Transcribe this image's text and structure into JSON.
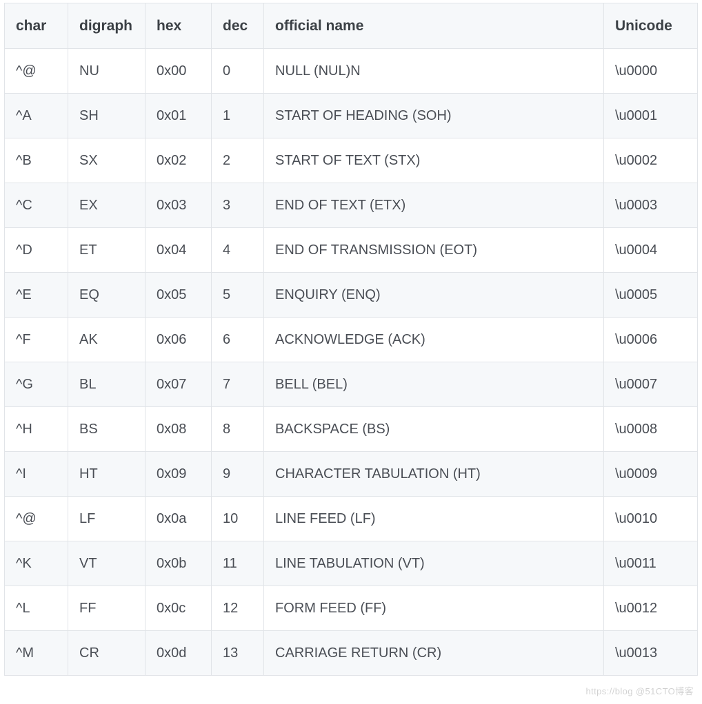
{
  "headers": {
    "char": "char",
    "digraph": "digraph",
    "hex": "hex",
    "dec": "dec",
    "official_name": "official name",
    "unicode": "Unicode"
  },
  "rows": [
    {
      "char": "^@",
      "digraph": "NU",
      "hex": "0x00",
      "dec": "0",
      "official_name": "NULL (NUL)N",
      "unicode": "\\u0000"
    },
    {
      "char": "^A",
      "digraph": "SH",
      "hex": "0x01",
      "dec": "1",
      "official_name": "START OF HEADING (SOH)",
      "unicode": "\\u0001"
    },
    {
      "char": "^B",
      "digraph": "SX",
      "hex": "0x02",
      "dec": "2",
      "official_name": "START OF TEXT (STX)",
      "unicode": "\\u0002"
    },
    {
      "char": "^C",
      "digraph": "EX",
      "hex": "0x03",
      "dec": "3",
      "official_name": "END OF TEXT (ETX)",
      "unicode": "\\u0003"
    },
    {
      "char": "^D",
      "digraph": "ET",
      "hex": "0x04",
      "dec": "4",
      "official_name": "END OF TRANSMISSION (EOT)",
      "unicode": "\\u0004"
    },
    {
      "char": "^E",
      "digraph": "EQ",
      "hex": "0x05",
      "dec": "5",
      "official_name": "ENQUIRY (ENQ)",
      "unicode": "\\u0005"
    },
    {
      "char": "^F",
      "digraph": "AK",
      "hex": "0x06",
      "dec": "6",
      "official_name": "ACKNOWLEDGE (ACK)",
      "unicode": "\\u0006"
    },
    {
      "char": "^G",
      "digraph": "BL",
      "hex": "0x07",
      "dec": "7",
      "official_name": "BELL (BEL)",
      "unicode": "\\u0007"
    },
    {
      "char": "^H",
      "digraph": "BS",
      "hex": "0x08",
      "dec": "8",
      "official_name": "BACKSPACE (BS)",
      "unicode": "\\u0008"
    },
    {
      "char": "^I",
      "digraph": "HT",
      "hex": "0x09",
      "dec": "9",
      "official_name": "CHARACTER TABULATION (HT)",
      "unicode": "\\u0009"
    },
    {
      "char": "^@",
      "digraph": "LF",
      "hex": "0x0a",
      "dec": "10",
      "official_name": "LINE FEED (LF)",
      "unicode": "\\u0010"
    },
    {
      "char": "^K",
      "digraph": "VT",
      "hex": "0x0b",
      "dec": "11",
      "official_name": "LINE TABULATION (VT)",
      "unicode": "\\u0011"
    },
    {
      "char": "^L",
      "digraph": "FF",
      "hex": "0x0c",
      "dec": "12",
      "official_name": "FORM FEED (FF)",
      "unicode": "\\u0012"
    },
    {
      "char": "^M",
      "digraph": "CR",
      "hex": "0x0d",
      "dec": "13",
      "official_name": "CARRIAGE RETURN (CR)",
      "unicode": "\\u0013"
    }
  ],
  "watermark": "https://blog  @51CTO博客",
  "chart_data": {
    "type": "table",
    "title": "",
    "columns": [
      "char",
      "digraph",
      "hex",
      "dec",
      "official name",
      "Unicode"
    ],
    "rows": [
      [
        "^@",
        "NU",
        "0x00",
        0,
        "NULL (NUL)N",
        "\\u0000"
      ],
      [
        "^A",
        "SH",
        "0x01",
        1,
        "START OF HEADING (SOH)",
        "\\u0001"
      ],
      [
        "^B",
        "SX",
        "0x02",
        2,
        "START OF TEXT (STX)",
        "\\u0002"
      ],
      [
        "^C",
        "EX",
        "0x03",
        3,
        "END OF TEXT (ETX)",
        "\\u0003"
      ],
      [
        "^D",
        "ET",
        "0x04",
        4,
        "END OF TRANSMISSION (EOT)",
        "\\u0004"
      ],
      [
        "^E",
        "EQ",
        "0x05",
        5,
        "ENQUIRY (ENQ)",
        "\\u0005"
      ],
      [
        "^F",
        "AK",
        "0x06",
        6,
        "ACKNOWLEDGE (ACK)",
        "\\u0006"
      ],
      [
        "^G",
        "BL",
        "0x07",
        7,
        "BELL (BEL)",
        "\\u0007"
      ],
      [
        "^H",
        "BS",
        "0x08",
        8,
        "BACKSPACE (BS)",
        "\\u0008"
      ],
      [
        "^I",
        "HT",
        "0x09",
        9,
        "CHARACTER TABULATION (HT)",
        "\\u0009"
      ],
      [
        "^@",
        "LF",
        "0x0a",
        10,
        "LINE FEED (LF)",
        "\\u0010"
      ],
      [
        "^K",
        "VT",
        "0x0b",
        11,
        "LINE TABULATION (VT)",
        "\\u0011"
      ],
      [
        "^L",
        "FF",
        "0x0c",
        12,
        "FORM FEED (FF)",
        "\\u0012"
      ],
      [
        "^M",
        "CR",
        "0x0d",
        13,
        "CARRIAGE RETURN (CR)",
        "\\u0013"
      ]
    ]
  }
}
